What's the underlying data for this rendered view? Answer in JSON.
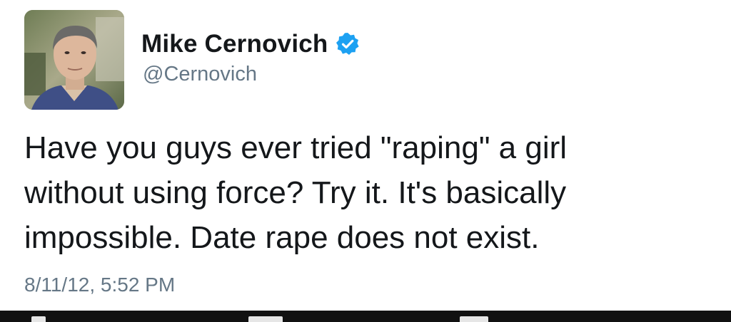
{
  "author": {
    "display_name": "Mike Cernovich",
    "handle": "@Cernovich",
    "verified": true,
    "avatar_icon": "profile-photo",
    "verified_color": "#1da1f2"
  },
  "tweet": {
    "lines": [
      "Have you guys ever tried \"raping\" a girl",
      "without using force? Try it. It's basically",
      "impossible. Date rape does not exist."
    ],
    "timestamp": "8/11/12, 5:52 PM"
  },
  "actions": {
    "icons": [
      "reply-icon",
      "retweet-icon",
      "like-icon"
    ]
  },
  "colors": {
    "text": "#14171a",
    "secondary": "#657786",
    "action_bar": "#111111"
  }
}
